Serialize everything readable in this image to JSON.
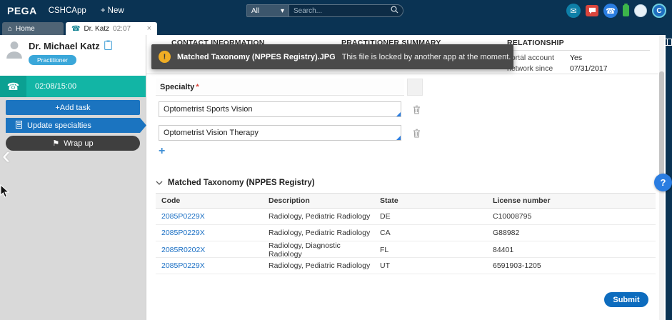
{
  "icons": {
    "caret_down": "▾",
    "home": "⌂",
    "phone": "☎",
    "tab_close": "×",
    "toast_close": "✕",
    "mail": "✉",
    "flag": "⚑",
    "warning": "!",
    "plus": "+",
    "chevron_left": "‹",
    "question": "?"
  },
  "topbar": {
    "logo": "PEGA",
    "app_name": "CSHCApp",
    "new_label": "+ New",
    "search_filter": "All",
    "search_placeholder": "Search...",
    "avatar_initial": "C"
  },
  "tabs": {
    "home_label": "Home",
    "active_label": "Dr. Katz",
    "active_time": "02:07"
  },
  "sidebar": {
    "name": "Dr. Michael Katz",
    "role_badge": "Practitioner",
    "call_timer": "02:08/15:00",
    "add_task": "+Add task",
    "update_specialties": "Update specialties",
    "wrap_up": "Wrap up"
  },
  "toast": {
    "title": "Matched Taxonomy (NPPES Registry).JPG",
    "message": "This file is locked by another app at the moment."
  },
  "summary": {
    "contact_header": "CONTACT INFORMATION",
    "practitioner_header": "PRACTITIONER SUMMARY",
    "relationship_header": "RELATIONSHIP",
    "relationship_rows": [
      {
        "label": "portal account",
        "value": "Yes"
      },
      {
        "label": "network since",
        "value": "07/31/2017"
      }
    ]
  },
  "form": {
    "specialty_label": "Specialty",
    "required_mark": "*",
    "fields": [
      "Optometrist Sports Vision",
      "Optometrist Vision Therapy"
    ]
  },
  "taxonomy": {
    "title": "Matched Taxonomy (NPPES Registry)",
    "headers": [
      "Code",
      "Description",
      "State",
      "License number"
    ],
    "rows": [
      {
        "code": "2085P0229X",
        "description": "Radiology, Pediatric Radiology",
        "state": "DE",
        "license": "C10008795"
      },
      {
        "code": "2085P0229X",
        "description": "Radiology, Pediatric Radiology",
        "state": "CA",
        "license": "G88982"
      },
      {
        "code": "2085R0202X",
        "description": "Radiology, Diagnostic Radiology",
        "state": "FL",
        "license": "84401"
      },
      {
        "code": "2085P0229X",
        "description": "Radiology, Pediatric Radiology",
        "state": "UT",
        "license": "6591903-1205"
      }
    ],
    "submit": "Submit"
  },
  "colors": {
    "topbar": "#0a3353",
    "accent_blue": "#1b74c0",
    "call_teal": "#12b5a5",
    "link_blue": "#1a6fc4",
    "submit_blue": "#0d6cbe",
    "toast_gray": "#4a4a4a",
    "warning_yellow": "#f0ad24"
  }
}
